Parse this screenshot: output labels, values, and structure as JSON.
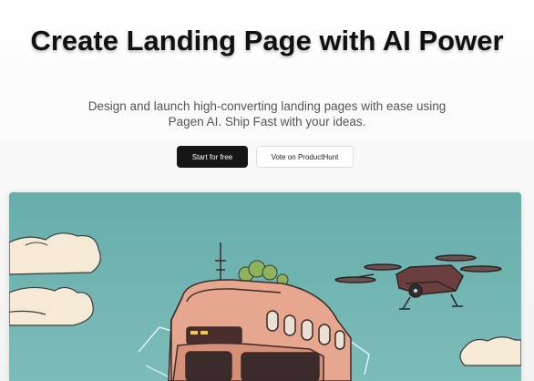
{
  "hero": {
    "title": "Create Landing Page with AI Power",
    "subtitle": "Design and launch high-converting landing pages with ease using Pagen AI. Ship Fast with your ideas."
  },
  "actions": {
    "primary_label": "Start for free",
    "secondary_label": "Vote on ProductHunt"
  },
  "colors": {
    "primary_button": "#161616",
    "illustration_sky": "#6db3b1",
    "building": "#e7a78f"
  }
}
